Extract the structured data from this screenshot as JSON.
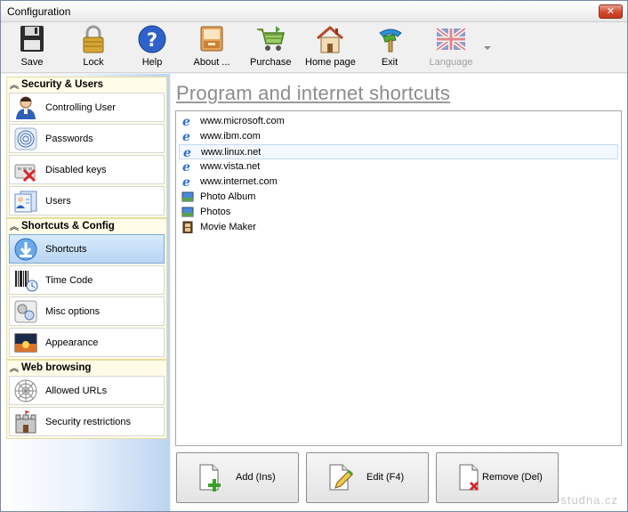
{
  "window": {
    "title": "Configuration",
    "close_label": "✕"
  },
  "toolbar": {
    "save": "Save",
    "lock": "Lock",
    "help": "Help",
    "about": "About ...",
    "purchase": "Purchase",
    "home": "Home page",
    "exit": "Exit",
    "language": "Language"
  },
  "sidebar": {
    "sections": [
      {
        "title": "Security & Users",
        "items": [
          "Controlling User",
          "Passwords",
          "Disabled keys",
          "Users"
        ]
      },
      {
        "title": "Shortcuts & Config",
        "items": [
          "Shortcuts",
          "Time Code",
          "Misc options",
          "Appearance"
        ],
        "selected": "Shortcuts"
      },
      {
        "title": "Web browsing",
        "items": [
          "Allowed URLs",
          "Security restrictions"
        ]
      }
    ]
  },
  "main": {
    "heading": "Program and internet shortcuts",
    "shortcuts": [
      {
        "label": "www.microsoft.com",
        "icon": "ie-icon"
      },
      {
        "label": "www.ibm.com",
        "icon": "ie-icon"
      },
      {
        "label": "www.linux.net",
        "icon": "ie-icon"
      },
      {
        "label": "www.vista.net",
        "icon": "ie-icon"
      },
      {
        "label": "www.internet.com",
        "icon": "ie-icon"
      },
      {
        "label": "Photo Album",
        "icon": "photo-icon"
      },
      {
        "label": "Photos",
        "icon": "photo-icon"
      },
      {
        "label": "Movie Maker",
        "icon": "film-icon"
      }
    ],
    "buttons": {
      "add": "Add (Ins)",
      "edit": "Edit (F4)",
      "remove": "Remove (Del)"
    }
  },
  "watermark": "studna.cz"
}
